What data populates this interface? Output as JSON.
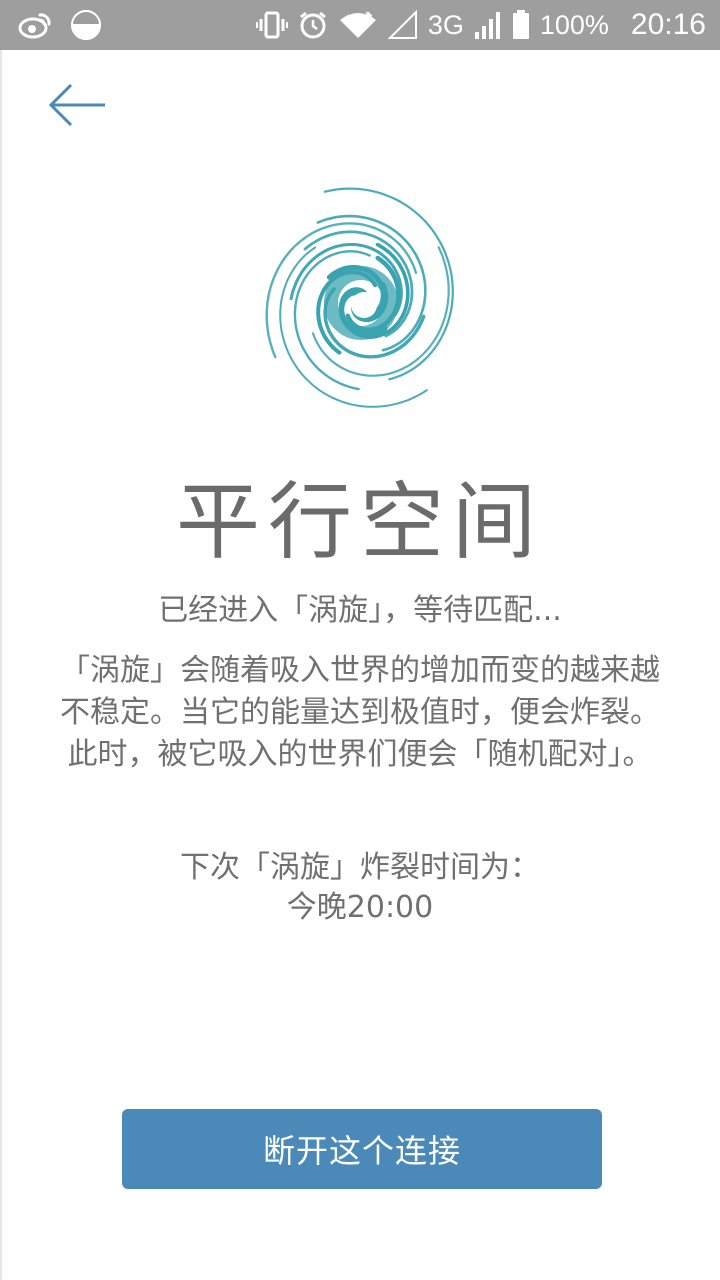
{
  "status_bar": {
    "battery_percent": "100%",
    "network": "3G",
    "time": "20:16",
    "icons": [
      "weibo-icon",
      "moon-icon",
      "vibrate-icon",
      "alarm-icon",
      "wifi-icon",
      "signal-icon",
      "battery-icon"
    ]
  },
  "nav": {
    "back_icon": "arrow-left-icon"
  },
  "colors": {
    "accent": "#4a89b8",
    "logo": "#3aa3b0",
    "text": "#707070",
    "status_bar": "#9e9e9e"
  },
  "main": {
    "title": "平行空间",
    "subtitle": "已经进入「涡旋」，等待匹配...",
    "description": "「涡旋」会随着吸入世界的增加而变的越来越不稳定。当它的能量达到极值时，便会炸裂。此时，被它吸入的世界们便会「随机配对」。",
    "next_explosion_label": "下次「涡旋」炸裂时间为：",
    "next_explosion_time": "今晚20:00"
  },
  "actions": {
    "disconnect_label": "断开这个连接"
  }
}
